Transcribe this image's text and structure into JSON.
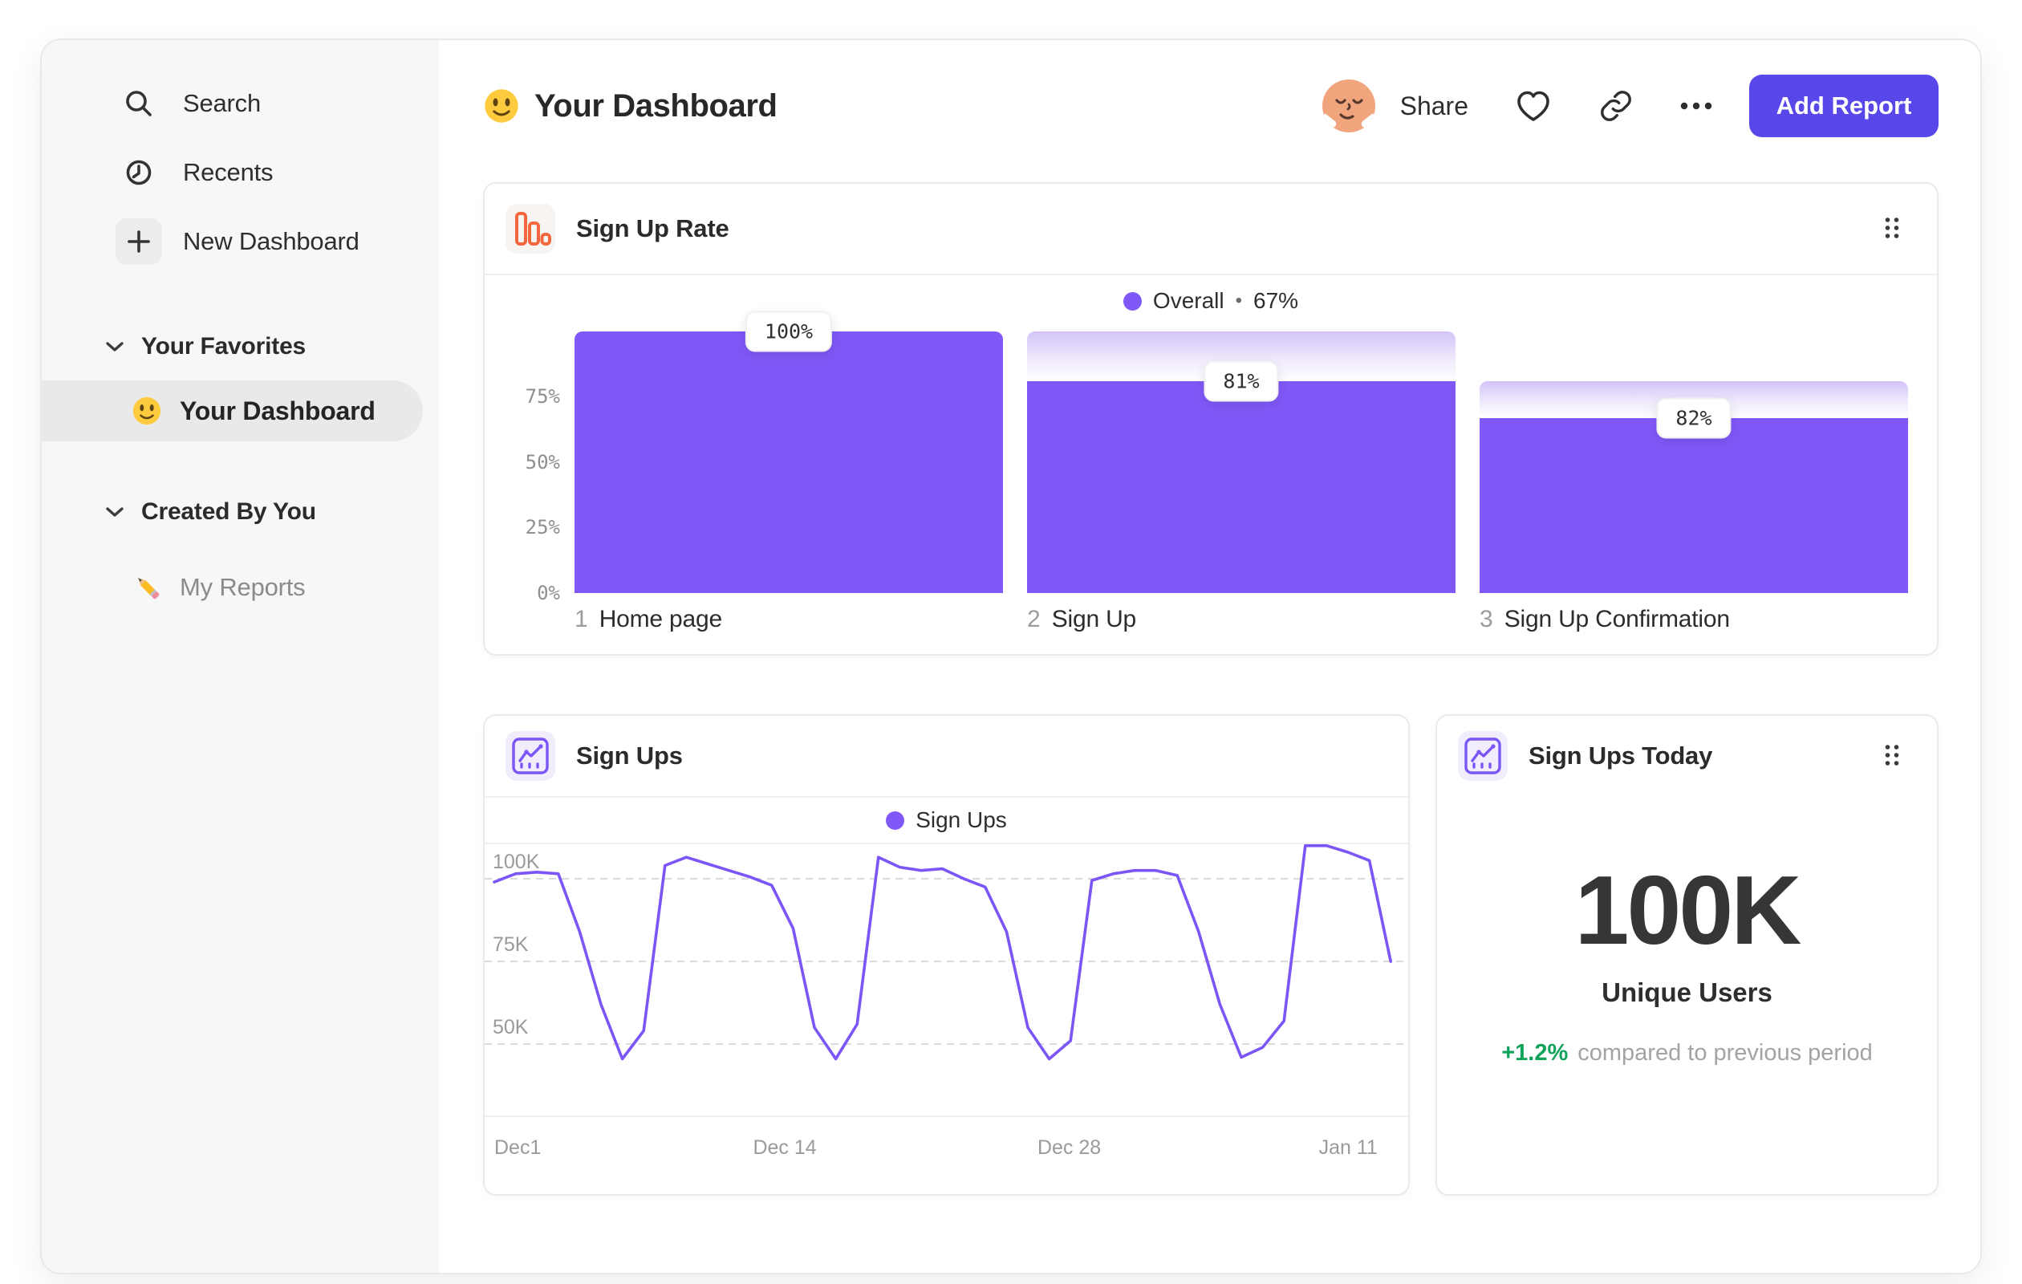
{
  "colors": {
    "accent": "#5847E9",
    "bar_purple": "#8158F8",
    "line_purple": "#7B55F6",
    "funnel_icon_orange": "#F4673E",
    "delta_green": "#0FA259",
    "sidebar_bg": "#F7F7F7"
  },
  "sidebar": {
    "items": [
      {
        "label": "Search",
        "icon": "search-icon"
      },
      {
        "label": "Recents",
        "icon": "clock-icon"
      },
      {
        "label": "New Dashboard",
        "icon": "plus-icon"
      }
    ],
    "sections": [
      {
        "label": "Your Favorites",
        "items": [
          {
            "label": "Your Dashboard",
            "icon": "smiley-emoji",
            "active": true
          }
        ]
      },
      {
        "label": "Created By You",
        "items": [
          {
            "label": "My Reports",
            "icon": "pencil-emoji",
            "active": false
          }
        ]
      }
    ]
  },
  "header": {
    "title": "Your Dashboard",
    "title_emoji": "slightly-smiling-face",
    "share_label": "Share",
    "add_report_label": "Add Report"
  },
  "cards": {
    "funnel": {
      "title": "Sign Up Rate",
      "legend": {
        "label": "Overall",
        "sep": "•",
        "value": "67%"
      },
      "y_ticks": [
        "75%",
        "50%",
        "25%",
        "0%"
      ],
      "steps": [
        {
          "num": "1",
          "name": "Home page",
          "badge": "100%",
          "solid_pct": 100,
          "prev_pct": 100
        },
        {
          "num": "2",
          "name": "Sign Up",
          "badge": "81%",
          "solid_pct": 81,
          "prev_pct": 100
        },
        {
          "num": "3",
          "name": "Sign Up Confirmation",
          "badge": "82%",
          "solid_pct": 67,
          "prev_pct": 81
        }
      ]
    },
    "line": {
      "title": "Sign Ups",
      "legend_label": "Sign Ups",
      "y_ticks": [
        "100K",
        "75K",
        "50K"
      ],
      "x_ticks": [
        "Dec1",
        "Dec 14",
        "Dec 28",
        "Jan 11"
      ]
    },
    "metric": {
      "title": "Sign Ups Today",
      "value": "100K",
      "label": "Unique Users",
      "delta": "+1.2%",
      "delta_text": "compared to previous period"
    }
  },
  "chart_data": [
    {
      "type": "bar",
      "variant": "funnel",
      "title": "Sign Up Rate",
      "legend_entries": [
        "Overall • 67%"
      ],
      "categories": [
        "Home page",
        "Sign Up",
        "Sign Up Confirmation"
      ],
      "values": [
        100,
        81,
        82
      ],
      "value_labels": [
        "100%",
        "81%",
        "82%"
      ],
      "cumulative_pct": [
        100,
        81,
        67
      ],
      "overall_conversion": "67%",
      "xlabel": "",
      "ylabel": "",
      "ylim": [
        0,
        100
      ],
      "y_ticks": [
        "0%",
        "25%",
        "50%",
        "75%"
      ],
      "grid": false,
      "legend_position": "top-center"
    },
    {
      "type": "line",
      "title": "Sign Ups",
      "categories": "daily, Dec 1 through Jan 12",
      "x_ticks": [
        "Dec1",
        "Dec 14",
        "Dec 28",
        "Jan 11"
      ],
      "y_ticks": [
        "50K",
        "75K",
        "100K"
      ],
      "ylim": [
        40,
        112
      ],
      "unit": "K",
      "grid": "dashed-horizontal",
      "legend_position": "top-center",
      "series": [
        {
          "name": "Sign Ups",
          "values": [
            99,
            101.5,
            102,
            101.5,
            84,
            62,
            45.5,
            54,
            104,
            106.5,
            104.5,
            102.5,
            100.5,
            98,
            85,
            55,
            45.5,
            56,
            106.5,
            103.5,
            102.5,
            103,
            100,
            97.5,
            84,
            55,
            45.5,
            51,
            99.5,
            101.5,
            102.5,
            102.5,
            101,
            84,
            62,
            46,
            49,
            57,
            110,
            110,
            108,
            105.5,
            75
          ]
        }
      ]
    }
  ]
}
